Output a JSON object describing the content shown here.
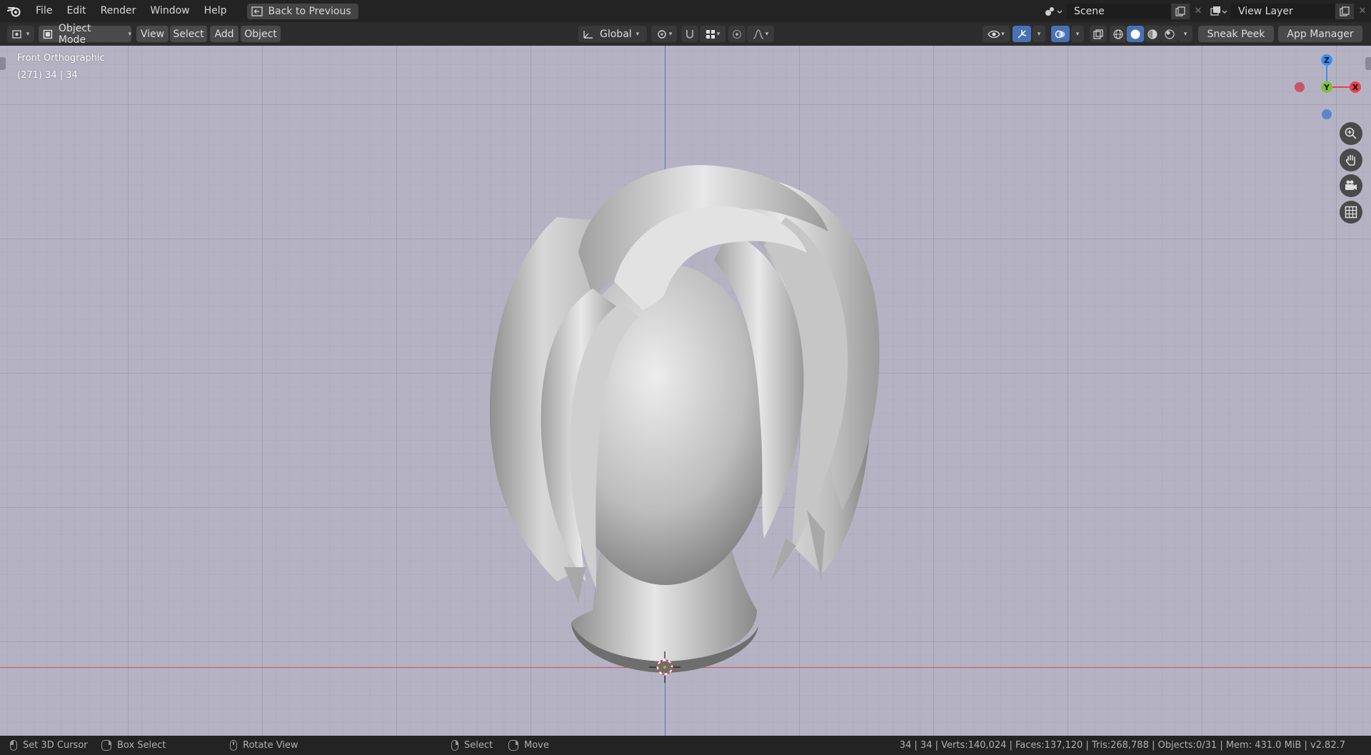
{
  "menu": {
    "items": [
      "File",
      "Edit",
      "Render",
      "Window",
      "Help"
    ],
    "back_button": "Back to Previous"
  },
  "top_right": {
    "scene": "Scene",
    "view_layer": "View Layer"
  },
  "header": {
    "mode": "Object Mode",
    "menus": [
      "View",
      "Select",
      "Add",
      "Object"
    ],
    "transform_orientation": "Global",
    "sneak_peek": "Sneak Peek",
    "app_manager": "App Manager"
  },
  "viewport": {
    "view_name": "Front Orthographic",
    "frame_info": "(271) 34 | 34"
  },
  "gizmo": {
    "z": "Z",
    "y": "Y",
    "x": "X",
    "colors": {
      "x": "#e8414f",
      "y": "#80c03a",
      "z": "#3c8ff0",
      "neg_x": "#c8566a",
      "neg_z": "#5a86cc"
    }
  },
  "status": {
    "set_cursor": "Set 3D Cursor",
    "box_select": "Box Select",
    "rotate_view": "Rotate View",
    "select": "Select",
    "move": "Move",
    "stats": "34 | 34 | Verts:140,024 | Faces:137,120 | Tris:268,788 | Objects:0/31 | Mem: 431.0 MiB | v2.82.7"
  }
}
